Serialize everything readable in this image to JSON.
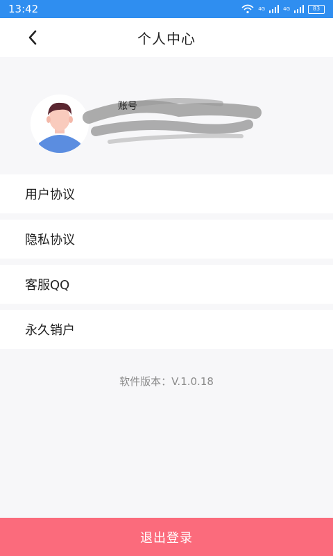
{
  "status_bar": {
    "time": "13:42",
    "network_1": "4G",
    "network_2": "4G",
    "battery": "83"
  },
  "header": {
    "title": "个人中心"
  },
  "profile": {
    "account_label": "账号"
  },
  "menu": {
    "items": [
      {
        "label": "用户协议"
      },
      {
        "label": "隐私协议"
      },
      {
        "label": "客服QQ"
      },
      {
        "label": "永久销户"
      }
    ]
  },
  "version_text": "软件版本：V.1.0.18",
  "logout_label": "退出登录",
  "colors": {
    "status_bar": "#2f8ef0",
    "logout_button": "#fb6b7c",
    "page_background": "#f7f7f9"
  }
}
